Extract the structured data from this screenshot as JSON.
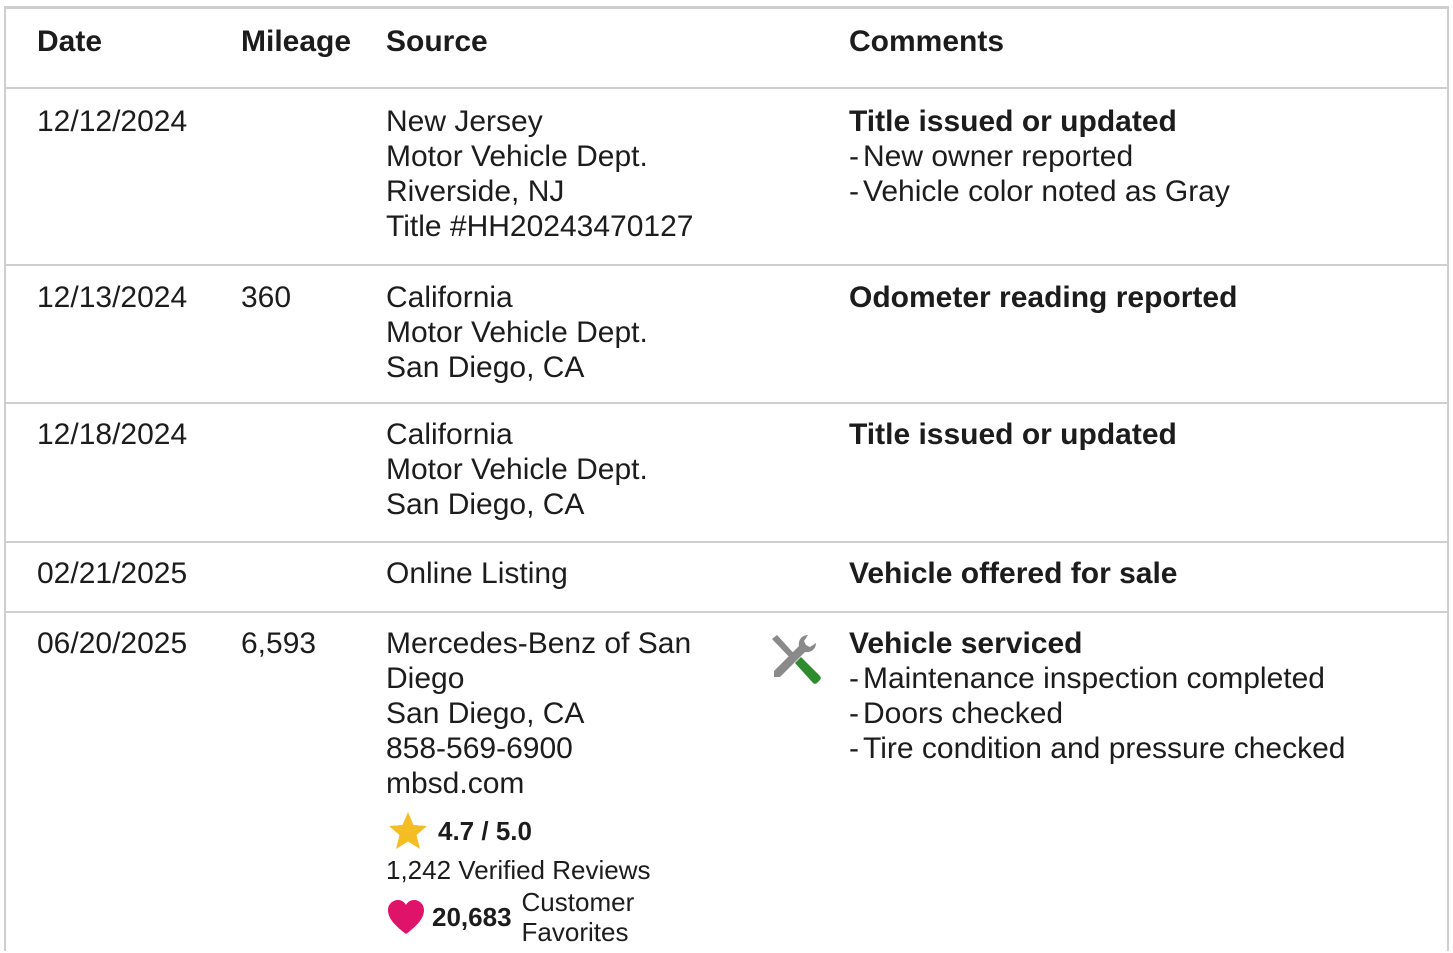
{
  "headers": {
    "date": "Date",
    "mileage": "Mileage",
    "source": "Source",
    "comments": "Comments"
  },
  "rows": [
    {
      "date": "12/12/2024",
      "mileage": "",
      "source": [
        "New Jersey",
        "Motor Vehicle Dept.",
        "Riverside, NJ",
        "Title #HH20243470127"
      ],
      "comment_title": "Title issued or updated",
      "comment_items": [
        "New owner reported",
        "Vehicle color noted as Gray"
      ]
    },
    {
      "date": "12/13/2024",
      "mileage": "360",
      "source": [
        "California",
        "Motor Vehicle Dept.",
        "San Diego, CA"
      ],
      "comment_title": "Odometer reading reported",
      "comment_items": []
    },
    {
      "date": "12/18/2024",
      "mileage": "",
      "source": [
        "California",
        "Motor Vehicle Dept.",
        "San Diego, CA"
      ],
      "comment_title": "Title issued or updated",
      "comment_items": []
    },
    {
      "date": "02/21/2025",
      "mileage": "",
      "source": [
        "Online Listing"
      ],
      "comment_title": "Vehicle offered for sale",
      "comment_items": []
    },
    {
      "date": "06/20/2025",
      "mileage": "6,593",
      "source": [
        "Mercedes-Benz of San Diego",
        "San Diego, CA",
        "858-569-6900",
        "mbsd.com"
      ],
      "service_icon": "wrench-screwdriver-icon",
      "rating": "4.7 / 5.0",
      "reviews": "1,242 Verified Reviews",
      "favorites_count": "20,683",
      "favorites_label": "Customer Favorites",
      "comment_title": "Vehicle serviced",
      "comment_items": [
        "Maintenance inspection completed",
        "Doors checked",
        "Tire condition and pressure checked"
      ]
    }
  ],
  "colors": {
    "border": "#cfcfcf",
    "star": "#f5bd24",
    "heart": "#e0136b",
    "wrench": "#8a8a8a",
    "screwdriver_handle": "#2e8b2e"
  }
}
